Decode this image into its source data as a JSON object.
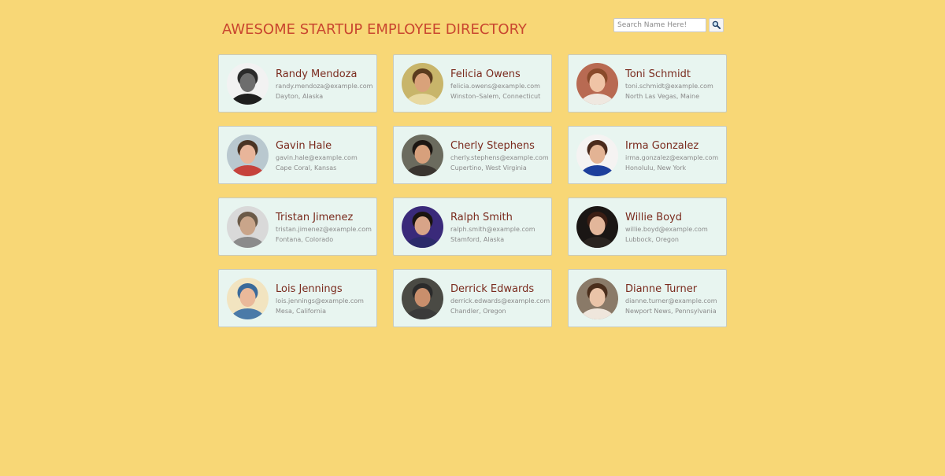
{
  "header": {
    "title": "AWESOME STARTUP EMPLOYEE DIRECTORY",
    "search_placeholder": "Search Name Here!",
    "search_icon": "magnifier-icon"
  },
  "employees": [
    {
      "name": "Randy Mendoza",
      "email": "randy.mendoza@example.com",
      "location": "Dayton, Alaska",
      "avatar": {
        "bg": "#f2f2f2",
        "skin": "#6d6d6d",
        "hair": "#2b2b2b",
        "shirt": "#1e1e1e"
      }
    },
    {
      "name": "Felicia Owens",
      "email": "felicia.owens@example.com",
      "location": "Winston–Salem, Connecticut",
      "avatar": {
        "bg": "#c8b56a",
        "skin": "#d9a27a",
        "hair": "#5a3b1e",
        "shirt": "#e8d9a0"
      }
    },
    {
      "name": "Toni Schmidt",
      "email": "toni.schmidt@example.com",
      "location": "North Las Vegas, Maine",
      "avatar": {
        "bg": "#b86a52",
        "skin": "#f0c4a6",
        "hair": "#8a4a2a",
        "shirt": "#efe8e0"
      }
    },
    {
      "name": "Gavin Hale",
      "email": "gavin.hale@example.com",
      "location": "Cape Coral, Kansas",
      "avatar": {
        "bg": "#b9c8cf",
        "skin": "#e8b59a",
        "hair": "#4a3424",
        "shirt": "#c6423c"
      }
    },
    {
      "name": "Cherly Stephens",
      "email": "cherly.stephens@example.com",
      "location": "Cupertino, West Virginia",
      "avatar": {
        "bg": "#6b6b5e",
        "skin": "#d7a07c",
        "hair": "#1c1612",
        "shirt": "#3a3530"
      }
    },
    {
      "name": "Irma Gonzalez",
      "email": "irma.gonzalez@example.com",
      "location": "Honolulu, New York",
      "avatar": {
        "bg": "#f5f3f2",
        "skin": "#e3b394",
        "hair": "#4a2a1c",
        "shirt": "#1d3f9c"
      }
    },
    {
      "name": "Tristan Jimenez",
      "email": "tristan.jimenez@example.com",
      "location": "Fontana, Colorado",
      "avatar": {
        "bg": "#d9d9d9",
        "skin": "#c9a58a",
        "hair": "#6b5a48",
        "shirt": "#8b8b8b"
      }
    },
    {
      "name": "Ralph Smith",
      "email": "ralph.smith@example.com",
      "location": "Stamford, Alaska",
      "avatar": {
        "bg": "#3a2a7a",
        "skin": "#d8a488",
        "hair": "#1a1410",
        "shirt": "#2b2b6a"
      }
    },
    {
      "name": "Willie Boyd",
      "email": "willie.boyd@example.com",
      "location": "Lubbock, Oregon",
      "avatar": {
        "bg": "#1a1614",
        "skin": "#e2b69a",
        "hair": "#3b1e14",
        "shirt": "#2a2420"
      }
    },
    {
      "name": "Lois Jennings",
      "email": "lois.jennings@example.com",
      "location": "Mesa, California",
      "avatar": {
        "bg": "#f2e4c0",
        "skin": "#eab99a",
        "hair": "#3a6a9a",
        "shirt": "#4a7aa8"
      }
    },
    {
      "name": "Derrick Edwards",
      "email": "derrick.edwards@example.com",
      "location": "Chandler, Oregon",
      "avatar": {
        "bg": "#4a4a44",
        "skin": "#c98f6c",
        "hair": "#2b2b2b",
        "shirt": "#3a3a3a"
      }
    },
    {
      "name": "Dianne Turner",
      "email": "dianne.turner@example.com",
      "location": "Newport News, Pennsylvania",
      "avatar": {
        "bg": "#8a7a68",
        "skin": "#eac4a8",
        "hair": "#4a2e1c",
        "shirt": "#efe6dc"
      }
    }
  ]
}
